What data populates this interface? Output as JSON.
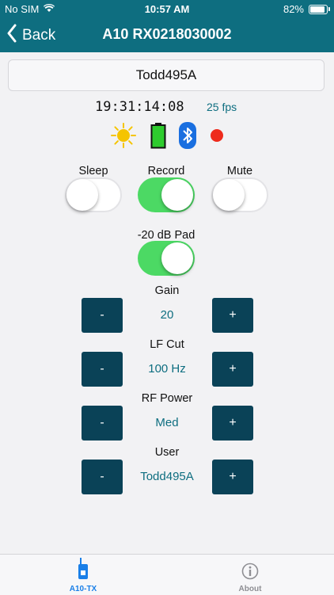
{
  "status": {
    "carrier": "No SIM",
    "time": "10:57 AM",
    "battery": "82%"
  },
  "nav": {
    "back_label": "Back",
    "title": "A10 RX0218030002"
  },
  "device_name": "Todd495A",
  "timecode": "19:31:14:08",
  "fps": "25 fps",
  "toggles": {
    "sleep": {
      "label": "Sleep",
      "on": false
    },
    "record": {
      "label": "Record",
      "on": true
    },
    "mute": {
      "label": "Mute",
      "on": false
    },
    "pad": {
      "label": "-20 dB Pad",
      "on": true
    }
  },
  "controls": {
    "gain": {
      "label": "Gain",
      "value": "20",
      "minus": "-",
      "plus": "+"
    },
    "lf_cut": {
      "label": "LF Cut",
      "value": "100 Hz",
      "minus": "-",
      "plus": "+"
    },
    "rf_power": {
      "label": "RF Power",
      "value": "Med",
      "minus": "-",
      "plus": "+"
    },
    "user": {
      "label": "User",
      "value": "Todd495A",
      "minus": "-",
      "plus": "+"
    }
  },
  "tabs": [
    {
      "label": "A10-TX",
      "active": true
    },
    {
      "label": "About",
      "active": false
    }
  ],
  "colors": {
    "header": "#0e6e80",
    "button": "#0a4257",
    "switch_on": "#4cd964",
    "record_dot": "#ee2b1c",
    "battery": "#2ecc2e",
    "bluetooth": "#1a6fe0",
    "sun": "#f5c400",
    "tab_active": "#1a7fe8",
    "tab_inactive": "#8e8e93"
  }
}
